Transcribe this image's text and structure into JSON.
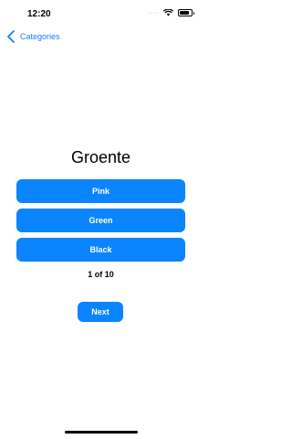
{
  "status_bar": {
    "time": "12:20",
    "cellular_icon": "cellular-dots-icon",
    "wifi_icon": "wifi-icon",
    "battery_icon": "battery-icon"
  },
  "nav": {
    "back_label": "Categories",
    "back_icon": "chevron-left-icon",
    "accent_color": "#1a7cf3"
  },
  "quiz": {
    "word": "Groente",
    "answers": [
      "Pink",
      "Green",
      "Black"
    ],
    "progress": "1 of 10",
    "next_label": "Next",
    "button_color": "#0a84ff"
  }
}
